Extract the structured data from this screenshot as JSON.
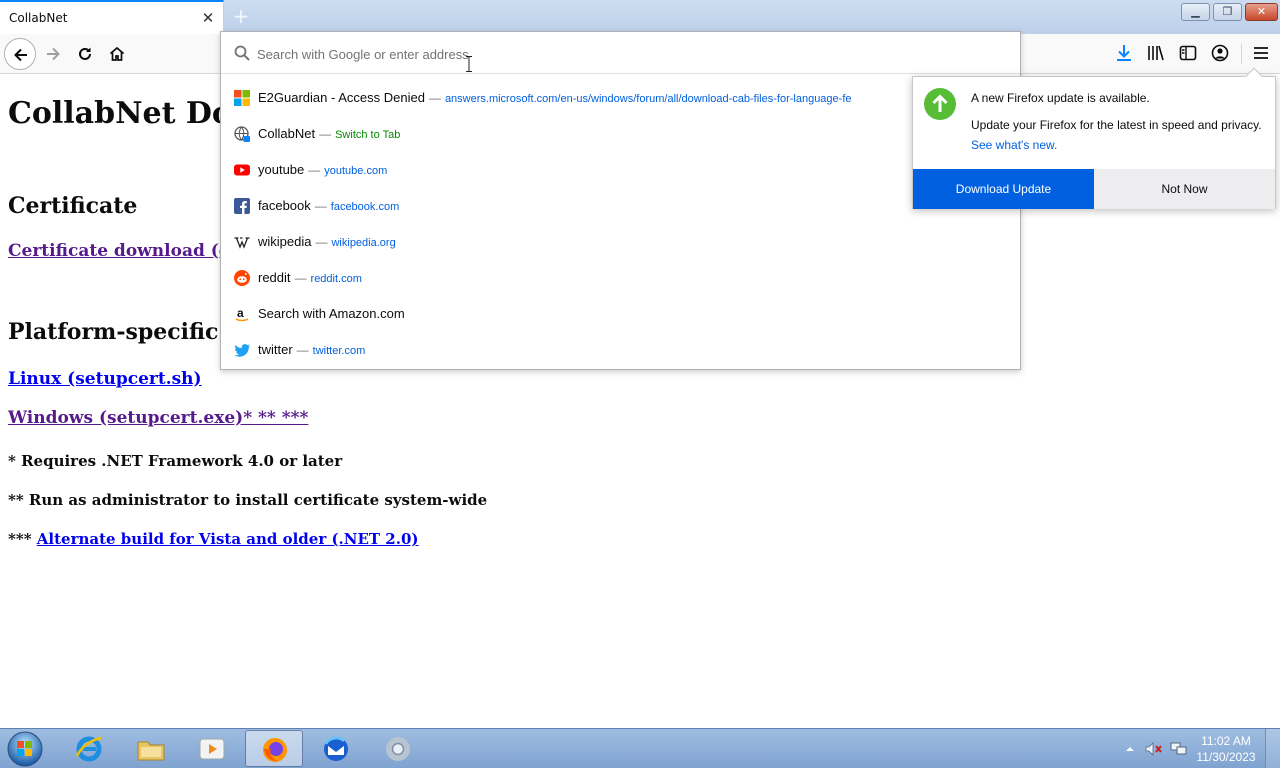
{
  "tab": {
    "title": "CollabNet"
  },
  "urlbar": {
    "placeholder": "Search with Google or enter address"
  },
  "suggestions": [
    {
      "title": "E2Guardian - Access Denied",
      "sep": "—",
      "url": "answers.microsoft.com/en-us/windows/forum/all/download-cab-files-for-language-fe",
      "icon": "microsoft-icon"
    },
    {
      "title": "CollabNet",
      "sep": "—",
      "action": "Switch to Tab",
      "icon": "globe-tab-icon"
    },
    {
      "title": "youtube",
      "sep": "—",
      "url": "youtube.com",
      "icon": "youtube-icon"
    },
    {
      "title": "facebook",
      "sep": "—",
      "url": "facebook.com",
      "icon": "facebook-icon"
    },
    {
      "title": "wikipedia",
      "sep": "—",
      "url": "wikipedia.org",
      "icon": "wikipedia-icon"
    },
    {
      "title": "reddit",
      "sep": "—",
      "url": "reddit.com",
      "icon": "reddit-icon"
    },
    {
      "title": "Search with Amazon.com",
      "icon": "amazon-icon"
    },
    {
      "title": "twitter",
      "sep": "—",
      "url": "twitter.com",
      "icon": "twitter-icon"
    }
  ],
  "update": {
    "title": "A new Firefox update is available.",
    "description": "Update your Firefox for the latest in speed and privacy.",
    "link": "See what's new.",
    "download_label": "Download Update",
    "notnow_label": "Not Now"
  },
  "page": {
    "title": "CollabNet Downloads",
    "cert_heading": "Certificate",
    "cert_link": "Certificate download (crt)",
    "platform_heading": "Platform-specific certificate installers",
    "linux_link": "Linux (setupcert.sh)",
    "windows_link": "Windows (setupcert.exe)* ** ***",
    "note1": "* Requires .NET Framework 4.0 or later",
    "note2": "** Run as administrator to install certificate system-wide",
    "note3_prefix": "*** ",
    "note3_link": "Alternate build for Vista and older (.NET 2.0)"
  },
  "taskbar": {
    "time": "11:02 AM",
    "date": "11/30/2023"
  },
  "colors": {
    "accent": "#0060df",
    "tab_highlight": "#0a84ff",
    "visited_link": "#551a8b",
    "link": "#0000ee"
  }
}
